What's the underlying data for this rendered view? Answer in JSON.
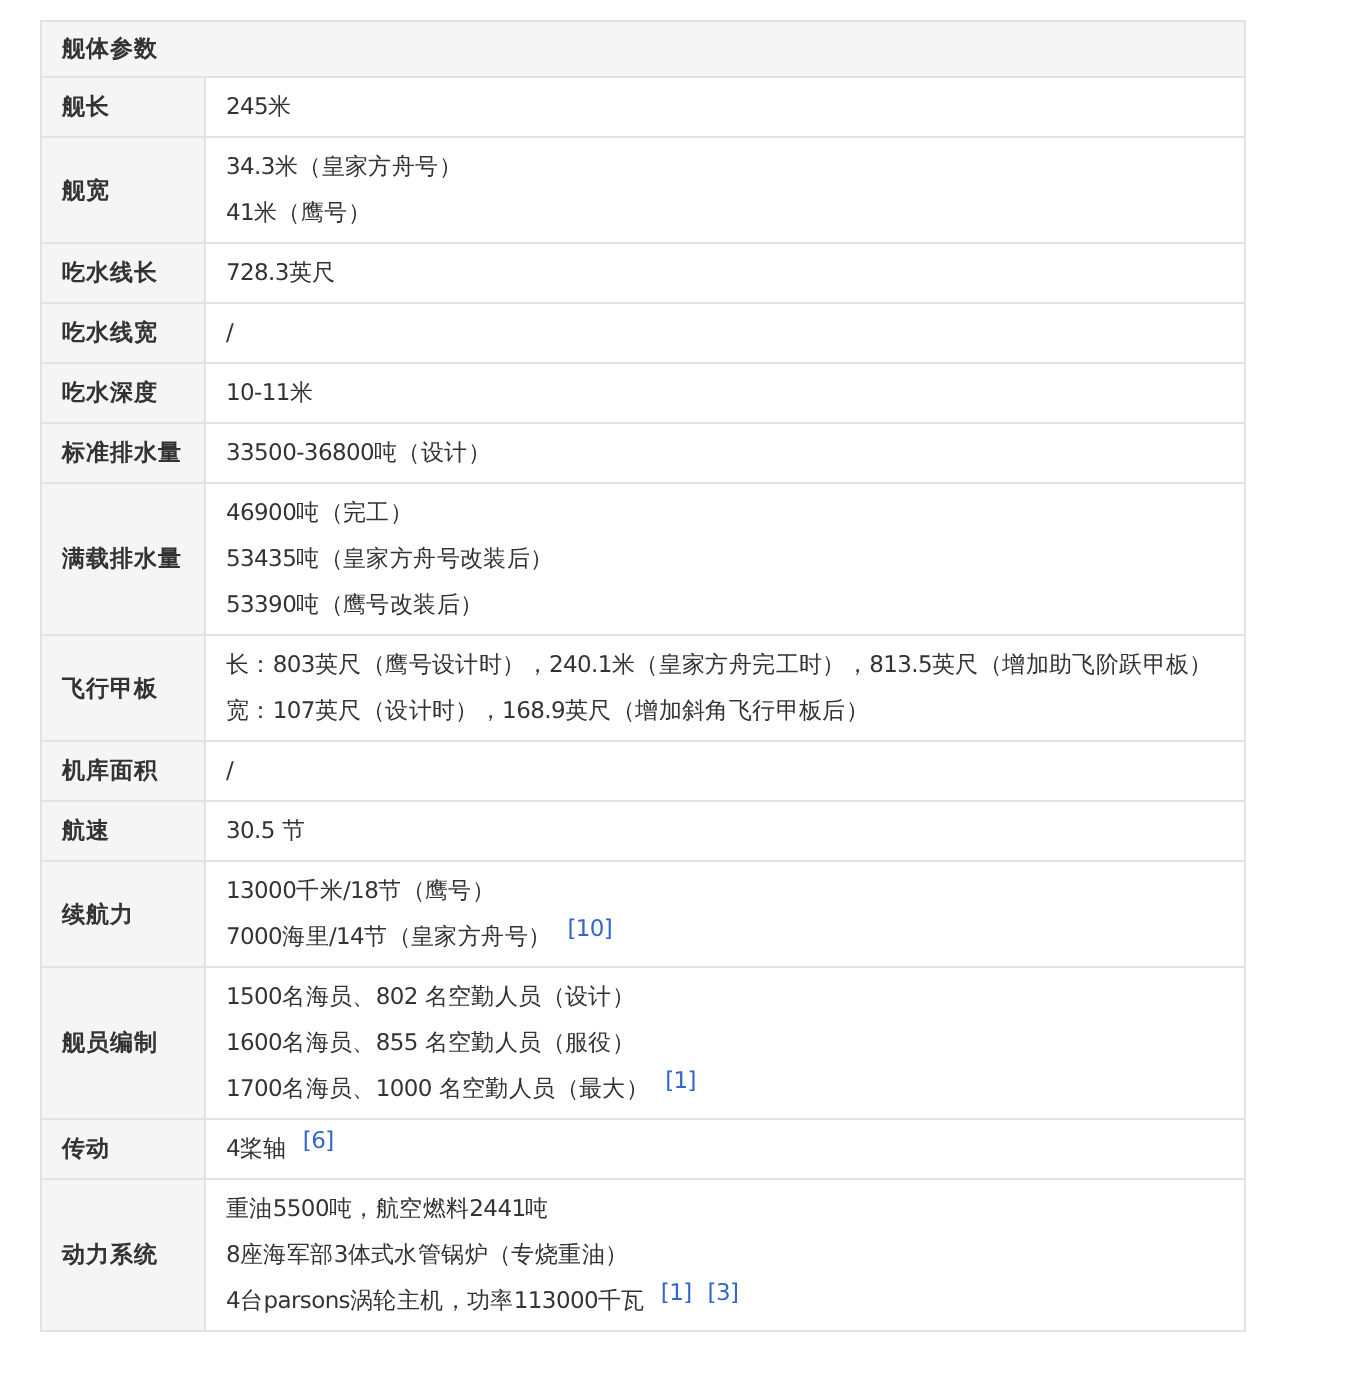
{
  "table": {
    "title": "舰体参数",
    "rows": [
      {
        "label": "舰长",
        "lines": [
          {
            "text": "245米"
          }
        ]
      },
      {
        "label": "舰宽",
        "lines": [
          {
            "text": "34.3米（皇家方舟号）"
          },
          {
            "text": "41米（鹰号）"
          }
        ]
      },
      {
        "label": "吃水线长",
        "lines": [
          {
            "text": "728.3英尺"
          }
        ]
      },
      {
        "label": "吃水线宽",
        "lines": [
          {
            "text": "/"
          }
        ]
      },
      {
        "label": "吃水深度",
        "lines": [
          {
            "text": "10-11米"
          }
        ]
      },
      {
        "label": "标准排水量",
        "lines": [
          {
            "text": "33500-36800吨（设计）"
          }
        ]
      },
      {
        "label": "满载排水量",
        "lines": [
          {
            "text": "46900吨（完工）"
          },
          {
            "text": "53435吨（皇家方舟号改装后）"
          },
          {
            "text": "53390吨（鹰号改装后）"
          }
        ]
      },
      {
        "label": "飞行甲板",
        "lines": [
          {
            "text": "长：803英尺（鹰号设计时），240.1米（皇家方舟完工时），813.5英尺（增加助飞阶跃甲板）"
          },
          {
            "text": "宽：107英尺（设计时），168.9英尺（增加斜角飞行甲板后）"
          }
        ]
      },
      {
        "label": "机库面积",
        "lines": [
          {
            "text": "/"
          }
        ]
      },
      {
        "label": "航速",
        "lines": [
          {
            "text": "30.5 节"
          }
        ]
      },
      {
        "label": "续航力",
        "lines": [
          {
            "text": "13000千米/18节（鹰号）"
          },
          {
            "text": "7000海里/14节（皇家方舟号）",
            "refs": [
              "[10]"
            ]
          }
        ]
      },
      {
        "label": "舰员编制",
        "lines": [
          {
            "text": "1500名海员、802 名空勤人员（设计）"
          },
          {
            "text": "1600名海员、855 名空勤人员（服役）"
          },
          {
            "text": "1700名海员、1000 名空勤人员（最大）",
            "refs": [
              "[1]"
            ]
          }
        ]
      },
      {
        "label": "传动",
        "lines": [
          {
            "text": "4桨轴",
            "refs": [
              "[6]"
            ]
          }
        ]
      },
      {
        "label": "动力系统",
        "lines": [
          {
            "text": "重油5500吨，航空燃料2441吨"
          },
          {
            "text": "8座海军部3体式水管锅炉（专烧重油）"
          },
          {
            "text": "4台parsons涡轮主机，功率113000千瓦",
            "refs": [
              "[1]",
              "[3]"
            ]
          }
        ]
      }
    ]
  }
}
